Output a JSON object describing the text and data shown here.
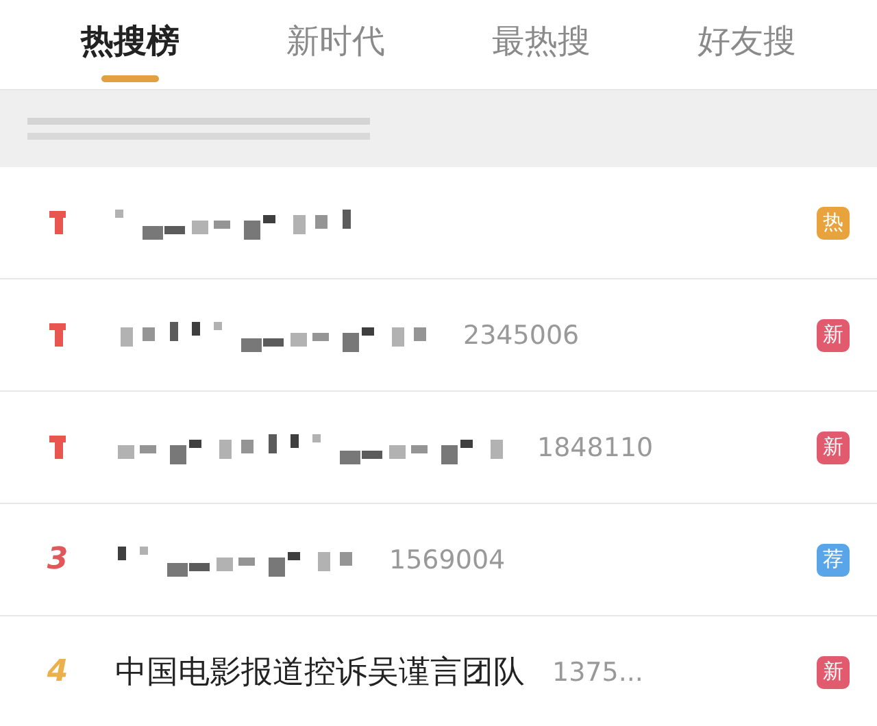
{
  "tabs": [
    {
      "label": "热搜榜",
      "selected": true
    },
    {
      "label": "新时代",
      "selected": false
    },
    {
      "label": "最热搜",
      "selected": false
    },
    {
      "label": "好友搜",
      "selected": false
    }
  ],
  "search": {
    "kind": "pixelated"
  },
  "items": [
    {
      "kind": "pixelated",
      "rank": {
        "color": "#e8564f"
      },
      "badge": {
        "label": "热",
        "color": "#e8a33d"
      }
    },
    {
      "kind": "pixelated",
      "rank": {
        "color": "#e8564f"
      },
      "count": "2345006",
      "badge": {
        "label": "新",
        "color": "#e25a6e"
      }
    },
    {
      "kind": "pixelated",
      "rank": {
        "color": "#e8564f"
      },
      "count": "1848110",
      "badge": {
        "label": "新",
        "color": "#e25a6e"
      }
    },
    {
      "kind": "pixelated",
      "rank": {
        "label": "3",
        "color": "#e0585a"
      },
      "count": "1569004",
      "badge": {
        "label": "荐",
        "color": "#5aa5e8"
      }
    },
    {
      "kind": "text",
      "rank": {
        "label": "4",
        "color": "#ebb04a"
      },
      "title": "中国电影报道控诉吴谨言团队",
      "count": "1375...",
      "badge": {
        "label": "新",
        "color": "#e25a6e"
      }
    }
  ]
}
